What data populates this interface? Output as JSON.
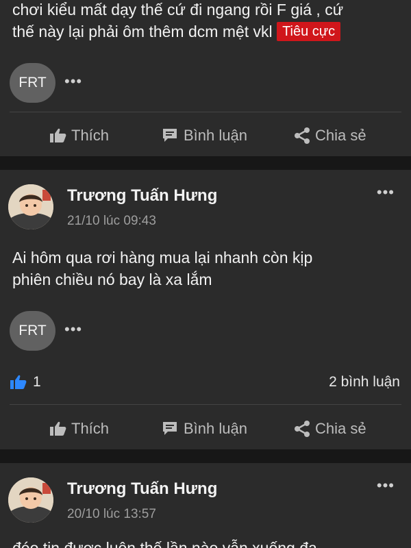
{
  "posts": [
    {
      "text_line1": "chơi kiểu mất dạy thế cứ đi ngang rồi F giá , cứ",
      "text_line2": "thế này lại phải ôm thêm dcm mệt vkl",
      "sentiment_tag": "Tiêu cực",
      "reply_badge": "FRT",
      "actions": {
        "like": "Thích",
        "comment": "Bình luận",
        "share": "Chia sẻ"
      }
    },
    {
      "author": "Trương Tuấn Hưng",
      "time": "21/10 lúc 09:43",
      "text_line1": "Ai hôm qua rơi hàng mua lại nhanh còn kịp",
      "text_line2": "phiên chiều nó bay là xa lắm",
      "reply_badge": "FRT",
      "like_count": "1",
      "comment_count": "2 bình luận",
      "actions": {
        "like": "Thích",
        "comment": "Bình luận",
        "share": "Chia sẻ"
      }
    },
    {
      "author": "Trương Tuấn Hưng",
      "time": "20/10 lúc 13:57",
      "text_line1": "đéo tin được luôn thế lần nào vẫn xuống đạ"
    }
  ],
  "more_glyph": "•••",
  "colors": {
    "background": "#2b2b2b",
    "separator": "#171717",
    "tag": "#d0161b",
    "like_blue": "#2d88ff"
  },
  "icons": [
    "thumbs-up-icon",
    "comment-icon",
    "share-icon",
    "more-dots-icon"
  ]
}
